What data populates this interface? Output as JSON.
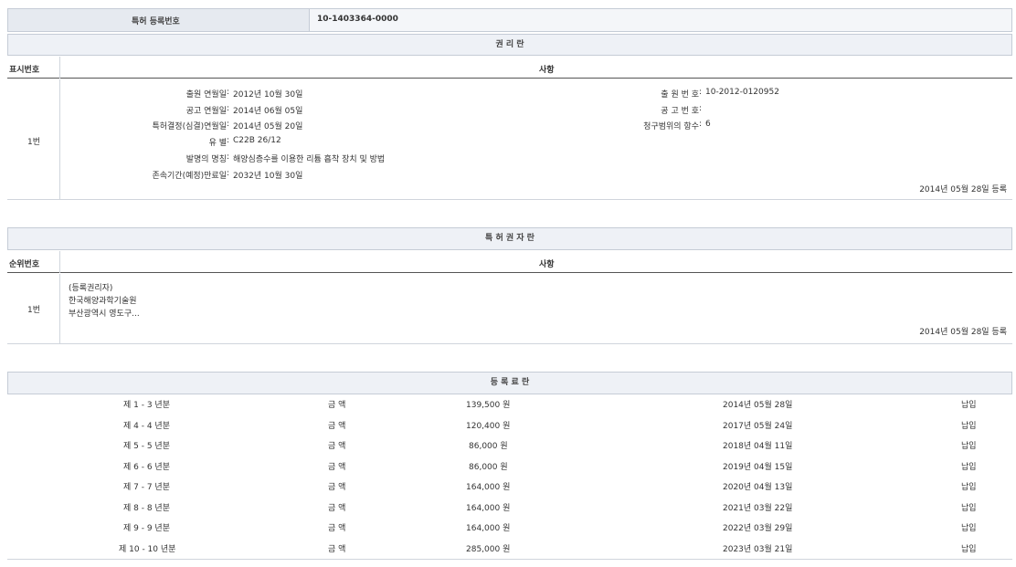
{
  "reg": {
    "label": "특허 등록번호",
    "value": "10-1403364-0000"
  },
  "rights": {
    "title": "권 리 란",
    "col_no": "표시번호",
    "col_item": "사항",
    "entry_no": "1번",
    "left": [
      {
        "label": "출원 연월일",
        "value": "2012년 10월 30일"
      },
      {
        "label": "공고 연월일",
        "value": "2014년 06월 05일"
      },
      {
        "label": "특허결정(심결)연월일",
        "value": "2014년 05월 20일"
      },
      {
        "label": "유 별",
        "value": "C22B 26/12"
      },
      {
        "label": "발명의 명칭",
        "value": "해양심층수를 이용한 리튬 흡착 장치 및 방법"
      },
      {
        "label": "존속기간(예정)만료일",
        "value": "2032년 10월 30일"
      }
    ],
    "right": [
      {
        "label": "출 원 번 호",
        "value": "10-2012-0120952"
      },
      {
        "label": "공 고 번 호",
        "value": ""
      },
      {
        "label": "청구범위의 항수",
        "value": "6"
      }
    ],
    "reg_date": "2014년 05월 28일 등록"
  },
  "holder": {
    "title": "특 허 권 자 란",
    "col_no": "순위번호",
    "col_item": "사항",
    "entry_no": "1번",
    "lines": [
      "(등록권리자)",
      "한국해양과학기술원",
      "부산광역시 영도구..."
    ],
    "reg_date": "2014년 05월 28일 등록"
  },
  "fees": {
    "title": "등 록 료 란",
    "amount_label": "금 액",
    "rows": [
      {
        "period": "제 1 - 3 년분",
        "amount": "139,500 원",
        "date": "2014년 05월 28일",
        "status": "납입"
      },
      {
        "period": "제 4 - 4 년분",
        "amount": "120,400 원",
        "date": "2017년 05월 24일",
        "status": "납입"
      },
      {
        "period": "제 5 - 5 년분",
        "amount": "86,000 원",
        "date": "2018년 04월 11일",
        "status": "납입"
      },
      {
        "period": "제 6 - 6 년분",
        "amount": "86,000 원",
        "date": "2019년 04월 15일",
        "status": "납입"
      },
      {
        "period": "제 7 - 7 년분",
        "amount": "164,000 원",
        "date": "2020년 04월 13일",
        "status": "납입"
      },
      {
        "period": "제 8 - 8 년분",
        "amount": "164,000 원",
        "date": "2021년 03월 22일",
        "status": "납입"
      },
      {
        "period": "제 9 - 9 년분",
        "amount": "164,000 원",
        "date": "2022년 03월 29일",
        "status": "납입"
      },
      {
        "period": "제 10 - 10 년분",
        "amount": "285,000 원",
        "date": "2023년 03월 21일",
        "status": "납입"
      }
    ]
  }
}
